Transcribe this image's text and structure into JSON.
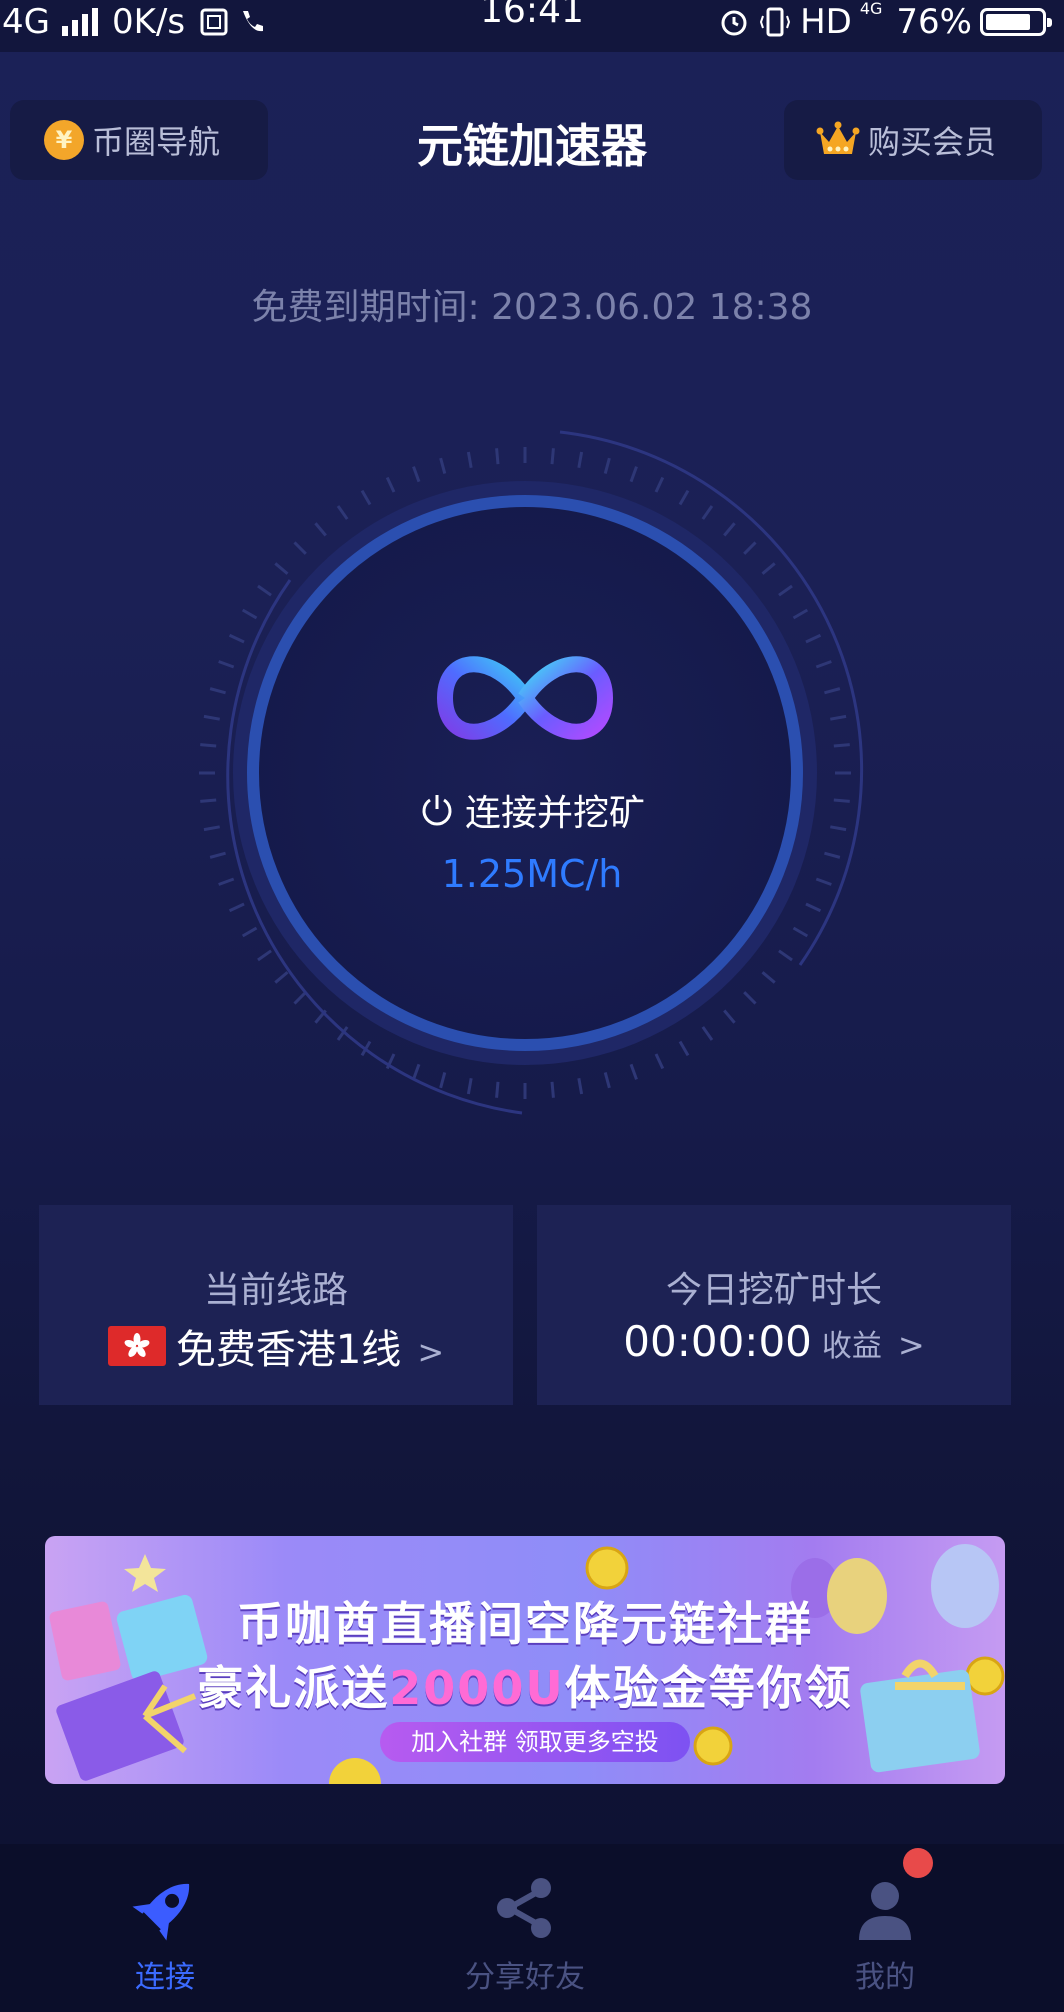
{
  "status_bar": {
    "network": "4G",
    "speed": "0K/s",
    "time": "16:41",
    "hd": "HD",
    "net_small": "4G",
    "battery": "76%",
    "battery_level": 0.76
  },
  "header": {
    "left_button": "币圈导航",
    "coin_symbol": "¥",
    "title": "元链加速器",
    "right_button": "购买会员"
  },
  "expiry": {
    "label": "免费到期时间:",
    "value": "2023.06.02 18:38"
  },
  "dial": {
    "connect_label": "连接并挖矿",
    "rate": "1.25MC/h",
    "icon": "infinity-logo-icon"
  },
  "cards": {
    "route_title": "当前线路",
    "route_name": "免费香港1线",
    "route_flag": "hong-kong-flag-icon",
    "mining_title": "今日挖矿时长",
    "mining_time": "00:00:00",
    "earnings_label": "收益",
    "chevron": ">"
  },
  "banner": {
    "line1": "币咖酋直播间空降元链社群",
    "line2_prefix": "豪礼派送",
    "line2_highlight": "2000U",
    "line2_suffix": "体验金等你领",
    "button": "加入社群 领取更多空投"
  },
  "tabs": [
    {
      "label": "连接",
      "icon": "rocket-icon",
      "active": true
    },
    {
      "label": "分享好友",
      "icon": "share-icon",
      "active": false
    },
    {
      "label": "我的",
      "icon": "profile-icon",
      "active": false,
      "has_badge": true
    }
  ],
  "colors": {
    "accent": "#2f7bff",
    "background": "#1b2157",
    "badge": "#e84a4a"
  }
}
